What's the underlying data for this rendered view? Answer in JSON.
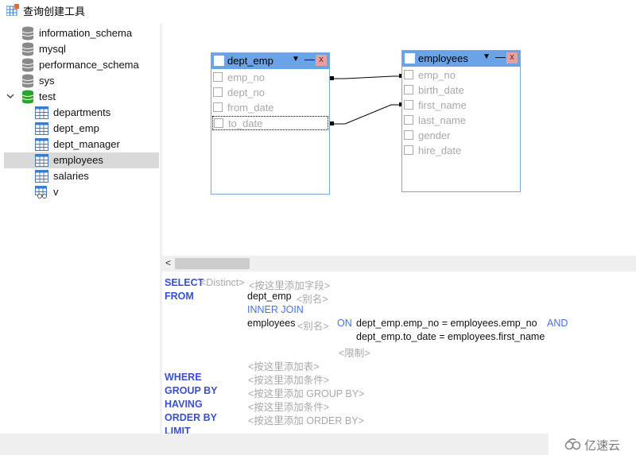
{
  "window": {
    "title": "查询创建工具",
    "icon": "query-builder-icon"
  },
  "sidebar": {
    "databases": [
      {
        "name": "information_schema",
        "icon": "database-icon",
        "expanded": false
      },
      {
        "name": "mysql",
        "icon": "database-icon",
        "expanded": false
      },
      {
        "name": "performance_schema",
        "icon": "database-icon",
        "expanded": false
      },
      {
        "name": "sys",
        "icon": "database-icon",
        "expanded": false
      },
      {
        "name": "test",
        "icon": "database-active-icon",
        "expanded": true
      }
    ],
    "test_objects": [
      {
        "name": "departments",
        "icon": "table-icon",
        "selected": false
      },
      {
        "name": "dept_emp",
        "icon": "table-icon",
        "selected": false
      },
      {
        "name": "dept_manager",
        "icon": "table-icon",
        "selected": false
      },
      {
        "name": "employees",
        "icon": "table-icon",
        "selected": true
      },
      {
        "name": "salaries",
        "icon": "table-icon",
        "selected": false
      },
      {
        "name": "v",
        "icon": "view-icon",
        "selected": false
      }
    ]
  },
  "diagram": {
    "tables": [
      {
        "name": "dept_emp",
        "columns": [
          "emp_no",
          "dept_no",
          "from_date",
          "to_date"
        ],
        "focused_column": "to_date"
      },
      {
        "name": "employees",
        "columns": [
          "emp_no",
          "birth_date",
          "first_name",
          "last_name",
          "gender",
          "hire_date"
        ]
      }
    ],
    "links": [
      {
        "from": "dept_emp.emp_no",
        "to": "employees.emp_no"
      },
      {
        "from": "dept_emp.to_date",
        "to": "employees.first_name"
      }
    ],
    "header_buttons": {
      "menu": "▼",
      "minimize": "—",
      "close": "x"
    }
  },
  "scrollbar": {
    "left_arrow": "<"
  },
  "sql": {
    "select_kw": "SELECT",
    "distinct_ph": "<Distinct>",
    "fields_ph": "<按这里添加字段>",
    "from_kw": "FROM",
    "table1": "dept_emp",
    "alias_ph": "<别名>",
    "join": "INNER JOIN",
    "table2": "employees",
    "on_kw": "ON",
    "cond1": "dept_emp.emp_no = employees.emp_no",
    "and_kw": "AND",
    "cond2": "dept_emp.to_date = employees.first_name",
    "limit_ph": "<限制>",
    "add_table_ph": "<按这里添加表>",
    "where_kw": "WHERE",
    "where_ph": "<按这里添加条件>",
    "groupby_kw": "GROUP BY",
    "groupby_ph": "<按这里添加 GROUP BY>",
    "having_kw": "HAVING",
    "having_ph": "<按这里添加条件>",
    "orderby_kw": "ORDER BY",
    "orderby_ph": "<按这里添加 ORDER BY>",
    "limit_kw": "LIMIT"
  },
  "watermark": {
    "text": "亿速云",
    "icon": "cloud-logo-icon"
  },
  "colors": {
    "header_blue": "#6aa3e8",
    "keyword_blue": "#3a4fd0",
    "placeholder_gray": "#a8a8a8",
    "db_green": "#2aa52a"
  }
}
